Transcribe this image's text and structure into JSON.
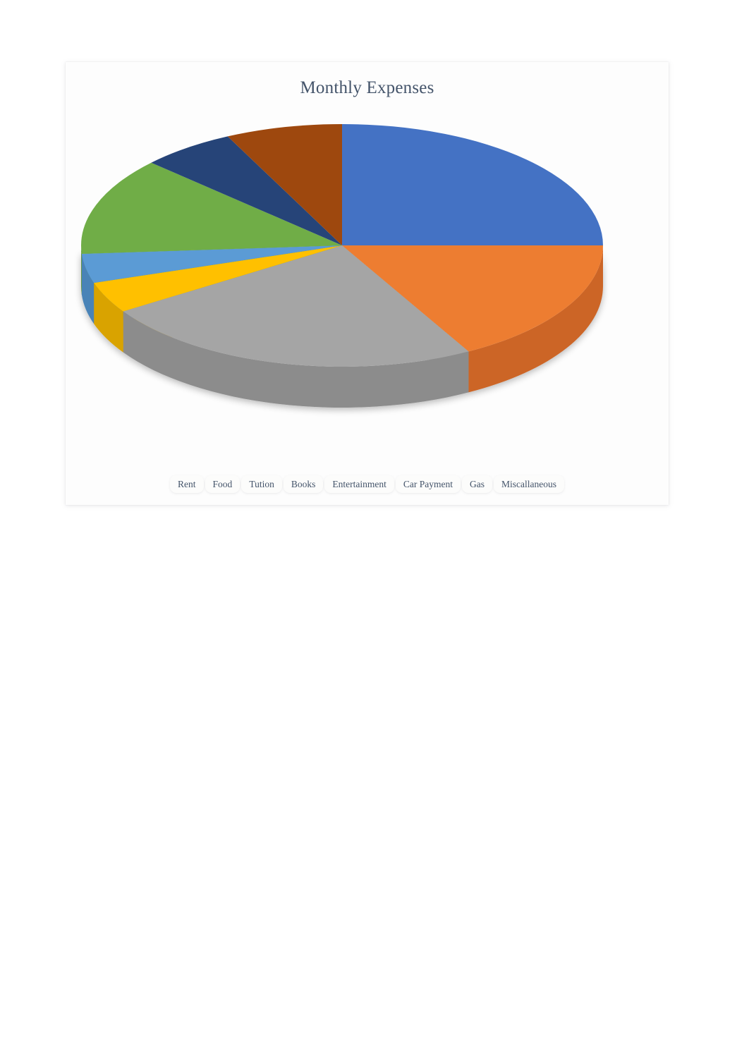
{
  "page": {
    "background_color": "#ffffff"
  },
  "card": {
    "background_color": "#fdfdfd"
  },
  "chart_data": {
    "type": "pie",
    "title": "Monthly Expenses",
    "subtitle": "",
    "xlabel": "",
    "ylabel": "",
    "three_d": true,
    "legend_position": "bottom",
    "grid": false,
    "start_angle_deg": 0,
    "direction": "clockwise",
    "labels": [
      "Rent",
      "Food",
      "Tution",
      "Books",
      "Entertainment",
      "Car Payment",
      "Gas",
      "Miscallaneous"
    ],
    "percentages": [
      25,
      17,
      24,
      4,
      4,
      13,
      6,
      7
    ],
    "values": [
      25,
      17,
      24,
      4,
      4,
      13,
      6,
      7
    ],
    "colors": [
      "#4472c4",
      "#ed7d31",
      "#a5a5a5",
      "#ffc000",
      "#5b9bd5",
      "#70ad47",
      "#264478",
      "#9e480e"
    ],
    "slices": [
      {
        "label": "Rent",
        "value": 25,
        "percent": 25,
        "color": "#4472c4",
        "side_color": "#3a63ab",
        "start_deg": 0,
        "end_deg": 90
      },
      {
        "label": "Food",
        "value": 17,
        "percent": 17,
        "color": "#ed7d31",
        "side_color": "#cc6526",
        "start_deg": 90,
        "end_deg": 151
      },
      {
        "label": "Tution",
        "value": 24,
        "percent": 24,
        "color": "#a5a5a5",
        "side_color": "#8c8c8c",
        "start_deg": 151,
        "end_deg": 237
      },
      {
        "label": "Books",
        "value": 4,
        "percent": 4,
        "color": "#ffc000",
        "side_color": "#d9a300",
        "start_deg": 237,
        "end_deg": 252
      },
      {
        "label": "Entertainment",
        "value": 4,
        "percent": 4,
        "color": "#5b9bd5",
        "side_color": "#4a83b7",
        "start_deg": 252,
        "end_deg": 266
      },
      {
        "label": "Car Payment",
        "value": 13,
        "percent": 13,
        "color": "#70ad47",
        "side_color": "#5d913b",
        "start_deg": 266,
        "end_deg": 313
      },
      {
        "label": "Gas",
        "value": 6,
        "percent": 6,
        "color": "#264478",
        "side_color": "#1e3761",
        "start_deg": 313,
        "end_deg": 334
      },
      {
        "label": "Miscallaneous",
        "value": 7,
        "percent": 7,
        "color": "#9e480e",
        "side_color": "#85390a",
        "start_deg": 334,
        "end_deg": 360
      }
    ]
  },
  "legend": {
    "items": [
      {
        "label": "Rent",
        "color": "#4472c4"
      },
      {
        "label": "Food",
        "color": "#ed7d31"
      },
      {
        "label": "Tution",
        "color": "#a5a5a5"
      },
      {
        "label": "Books",
        "color": "#ffc000"
      },
      {
        "label": "Entertainment",
        "color": "#5b9bd5"
      },
      {
        "label": "Car Payment",
        "color": "#70ad47"
      },
      {
        "label": "Gas",
        "color": "#264478"
      },
      {
        "label": "Miscallaneous",
        "color": "#9e480e"
      }
    ]
  }
}
